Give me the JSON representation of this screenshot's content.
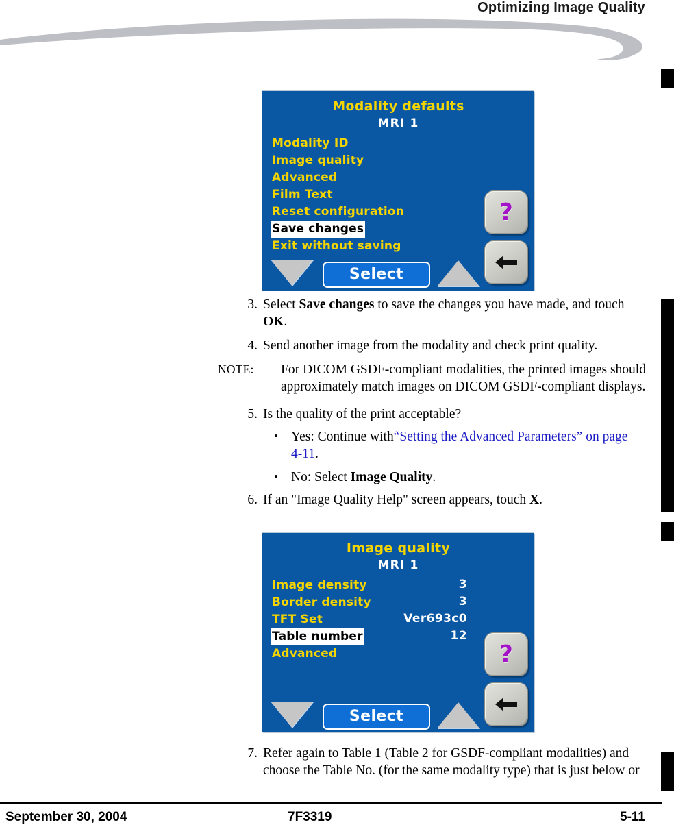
{
  "header": {
    "title": "Optimizing Image Quality",
    "swoosh_color": "#bdbfc4"
  },
  "screens": [
    {
      "name": "modality-defaults",
      "title": "Modality defaults",
      "subtitle": "MRI 1",
      "items": [
        {
          "label": "Modality ID",
          "value": "",
          "selected": false
        },
        {
          "label": "Image quality",
          "value": "",
          "selected": false
        },
        {
          "label": "Advanced",
          "value": "",
          "selected": false
        },
        {
          "label": "Film Text",
          "value": "",
          "selected": false
        },
        {
          "label": "Reset configuration",
          "value": "",
          "selected": false
        },
        {
          "label": "Save changes",
          "value": "",
          "selected": true
        },
        {
          "label": "Exit without saving",
          "value": "",
          "selected": false
        }
      ],
      "select_label": "Select",
      "help_glyph": "?",
      "colors": {
        "screen_background": "#0a57a4",
        "label": "#f5d500",
        "value": "#ffffff",
        "select_button": "#0f6fd6",
        "help_glyph": "#a313c8"
      }
    },
    {
      "name": "image-quality",
      "title": "Image quality",
      "subtitle": "MRI 1",
      "items": [
        {
          "label": "Image density",
          "value": "3",
          "selected": false
        },
        {
          "label": "Border density",
          "value": "3",
          "selected": false
        },
        {
          "label": "TFT Set",
          "value": "Ver693c0",
          "selected": false
        },
        {
          "label": "Table number",
          "value": "12",
          "selected": true
        },
        {
          "label": "Advanced",
          "value": "",
          "selected": false
        }
      ],
      "select_label": "Select",
      "help_glyph": "?",
      "colors": {
        "screen_background": "#0a57a4",
        "label": "#f5d500",
        "value": "#ffffff",
        "select_button": "#0f6fd6",
        "help_glyph": "#a313c8"
      }
    }
  ],
  "body": {
    "step3": {
      "marker": "3.",
      "text_a": "Select ",
      "bold_a": "Save changes",
      "text_b": " to save the changes you have made, and touch ",
      "bold_b": "OK",
      "text_c": "."
    },
    "step4": {
      "marker": "4.",
      "text": "Send another image from the modality and check print quality."
    },
    "note": {
      "marker": "NOTE:",
      "text": "For DICOM GSDF-compliant modalities, the printed images should approximately match images on DICOM GSDF-compliant displays."
    },
    "step5": {
      "marker": "5.",
      "text": "Is the quality of the print acceptable?",
      "bullets": [
        {
          "marker": "•",
          "text_a": "Yes: Continue with",
          "link": "“Setting the Advanced Parameters” on page 4-11",
          "text_b": "."
        },
        {
          "marker": "•",
          "text_a": "No: Select ",
          "bold": "Image Quality",
          "text_b": "."
        }
      ]
    },
    "step6": {
      "marker": "6.",
      "text_a": "If an \"Image Quality Help\" screen appears, touch ",
      "bold": "X",
      "text_b": "."
    },
    "step7": {
      "marker": "7.",
      "text": "Refer again to Table 1 (Table 2 for GSDF-compliant modalities) and choose the Table No. (for the same modality type) that is just below or"
    }
  },
  "footer": {
    "date": "September 30, 2004",
    "document_id": "7F3319",
    "page": "5-11"
  }
}
